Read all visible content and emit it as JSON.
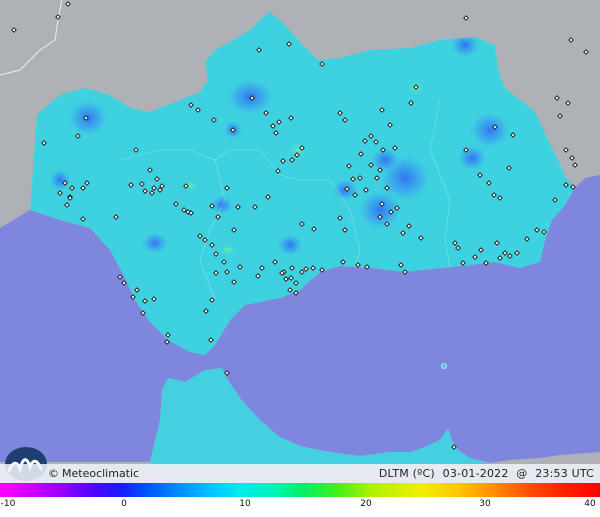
{
  "map": {
    "region": "Andalucía",
    "colors": {
      "sea": "#7f86de",
      "land_outside": "#aeb1b6",
      "land_region": "#3ed2e0",
      "cold_spot": "#3f8ff0",
      "warm_spot": "#5ee6b0",
      "station_marker": "#ffffff",
      "border": "#ffffff"
    },
    "icons": {
      "station": "station-dot-icon",
      "logo": "meteoclimatic-wave-icon",
      "copyright": "copyright-icon"
    }
  },
  "brand": {
    "copyright_symbol": "©",
    "name": "Meteoclimatic"
  },
  "stamp": {
    "variable": "DLTM (ºC)",
    "date": "03-01-2022",
    "at": "@",
    "time": "23:53 UTC"
  },
  "scale": {
    "ticks": [
      "-10",
      "0",
      "10",
      "20",
      "30",
      "40"
    ],
    "min": -10,
    "max": 40
  },
  "stations": [
    [
      14,
      30
    ],
    [
      58,
      17
    ],
    [
      68,
      4
    ],
    [
      466,
      18
    ],
    [
      571,
      40
    ],
    [
      586,
      52
    ],
    [
      557,
      98
    ],
    [
      568,
      103
    ],
    [
      560,
      116
    ],
    [
      566,
      150
    ],
    [
      572,
      158
    ],
    [
      575,
      165
    ],
    [
      566,
      185
    ],
    [
      573,
      187
    ],
    [
      555,
      200
    ],
    [
      259,
      50
    ],
    [
      289,
      44
    ],
    [
      322,
      64
    ],
    [
      416,
      87
    ],
    [
      411,
      103
    ],
    [
      252,
      98
    ],
    [
      191,
      105
    ],
    [
      198,
      110
    ],
    [
      214,
      120
    ],
    [
      233,
      130
    ],
    [
      266,
      113
    ],
    [
      273,
      126
    ],
    [
      279,
      122
    ],
    [
      291,
      118
    ],
    [
      276,
      133
    ],
    [
      340,
      113
    ],
    [
      345,
      120
    ],
    [
      382,
      110
    ],
    [
      390,
      125
    ],
    [
      371,
      136
    ],
    [
      365,
      141
    ],
    [
      376,
      142
    ],
    [
      383,
      150
    ],
    [
      361,
      154
    ],
    [
      371,
      165
    ],
    [
      380,
      170
    ],
    [
      395,
      148
    ],
    [
      302,
      148
    ],
    [
      297,
      155
    ],
    [
      292,
      160
    ],
    [
      283,
      161
    ],
    [
      278,
      171
    ],
    [
      349,
      166
    ],
    [
      353,
      179
    ],
    [
      347,
      189
    ],
    [
      355,
      195
    ],
    [
      360,
      178
    ],
    [
      377,
      178
    ],
    [
      387,
      188
    ],
    [
      366,
      190
    ],
    [
      382,
      204
    ],
    [
      380,
      217
    ],
    [
      391,
      212
    ],
    [
      397,
      208
    ],
    [
      409,
      226
    ],
    [
      466,
      150
    ],
    [
      495,
      127
    ],
    [
      513,
      135
    ],
    [
      509,
      168
    ],
    [
      494,
      195
    ],
    [
      500,
      198
    ],
    [
      489,
      183
    ],
    [
      480,
      175
    ],
    [
      86,
      118
    ],
    [
      78,
      136
    ],
    [
      44,
      143
    ],
    [
      65,
      183
    ],
    [
      60,
      193
    ],
    [
      70,
      197
    ],
    [
      72,
      188
    ],
    [
      87,
      183
    ],
    [
      83,
      188
    ],
    [
      70,
      198
    ],
    [
      67,
      205
    ],
    [
      83,
      219
    ],
    [
      116,
      217
    ],
    [
      131,
      185
    ],
    [
      142,
      184
    ],
    [
      145,
      191
    ],
    [
      154,
      188
    ],
    [
      162,
      186
    ],
    [
      157,
      179
    ],
    [
      150,
      170
    ],
    [
      152,
      193
    ],
    [
      160,
      190
    ],
    [
      186,
      186
    ],
    [
      184,
      210
    ],
    [
      188,
      212
    ],
    [
      191,
      213
    ],
    [
      212,
      206
    ],
    [
      218,
      217
    ],
    [
      176,
      204
    ],
    [
      255,
      207
    ],
    [
      268,
      197
    ],
    [
      227,
      188
    ],
    [
      238,
      207
    ],
    [
      234,
      230
    ],
    [
      302,
      224
    ],
    [
      314,
      229
    ],
    [
      340,
      218
    ],
    [
      345,
      230
    ],
    [
      387,
      224
    ],
    [
      403,
      233
    ],
    [
      421,
      238
    ],
    [
      455,
      243
    ],
    [
      458,
      248
    ],
    [
      475,
      257
    ],
    [
      481,
      250
    ],
    [
      497,
      243
    ],
    [
      505,
      253
    ],
    [
      510,
      256
    ],
    [
      517,
      253
    ],
    [
      527,
      239
    ],
    [
      537,
      230
    ],
    [
      544,
      232
    ],
    [
      136,
      150
    ],
    [
      200,
      236
    ],
    [
      205,
      240
    ],
    [
      212,
      245
    ],
    [
      216,
      254
    ],
    [
      224,
      262
    ],
    [
      216,
      273
    ],
    [
      240,
      267
    ],
    [
      227,
      272
    ],
    [
      258,
      276
    ],
    [
      275,
      262
    ],
    [
      284,
      272
    ],
    [
      291,
      278
    ],
    [
      296,
      283
    ],
    [
      290,
      290
    ],
    [
      296,
      293
    ],
    [
      302,
      272
    ],
    [
      306,
      269
    ],
    [
      313,
      268
    ],
    [
      322,
      270
    ],
    [
      262,
      268
    ],
    [
      282,
      273
    ],
    [
      343,
      262
    ],
    [
      358,
      265
    ],
    [
      367,
      267
    ],
    [
      401,
      265
    ],
    [
      405,
      272
    ],
    [
      463,
      263
    ],
    [
      486,
      263
    ],
    [
      500,
      258
    ],
    [
      120,
      277
    ],
    [
      124,
      283
    ],
    [
      133,
      297
    ],
    [
      137,
      290
    ],
    [
      145,
      301
    ],
    [
      143,
      313
    ],
    [
      168,
      335
    ],
    [
      167,
      342
    ],
    [
      211,
      340
    ],
    [
      227,
      373
    ],
    [
      212,
      300
    ],
    [
      206,
      311
    ],
    [
      292,
      268
    ],
    [
      286,
      279
    ],
    [
      234,
      282
    ],
    [
      454,
      447
    ],
    [
      444,
      366
    ],
    [
      154,
      299
    ]
  ]
}
